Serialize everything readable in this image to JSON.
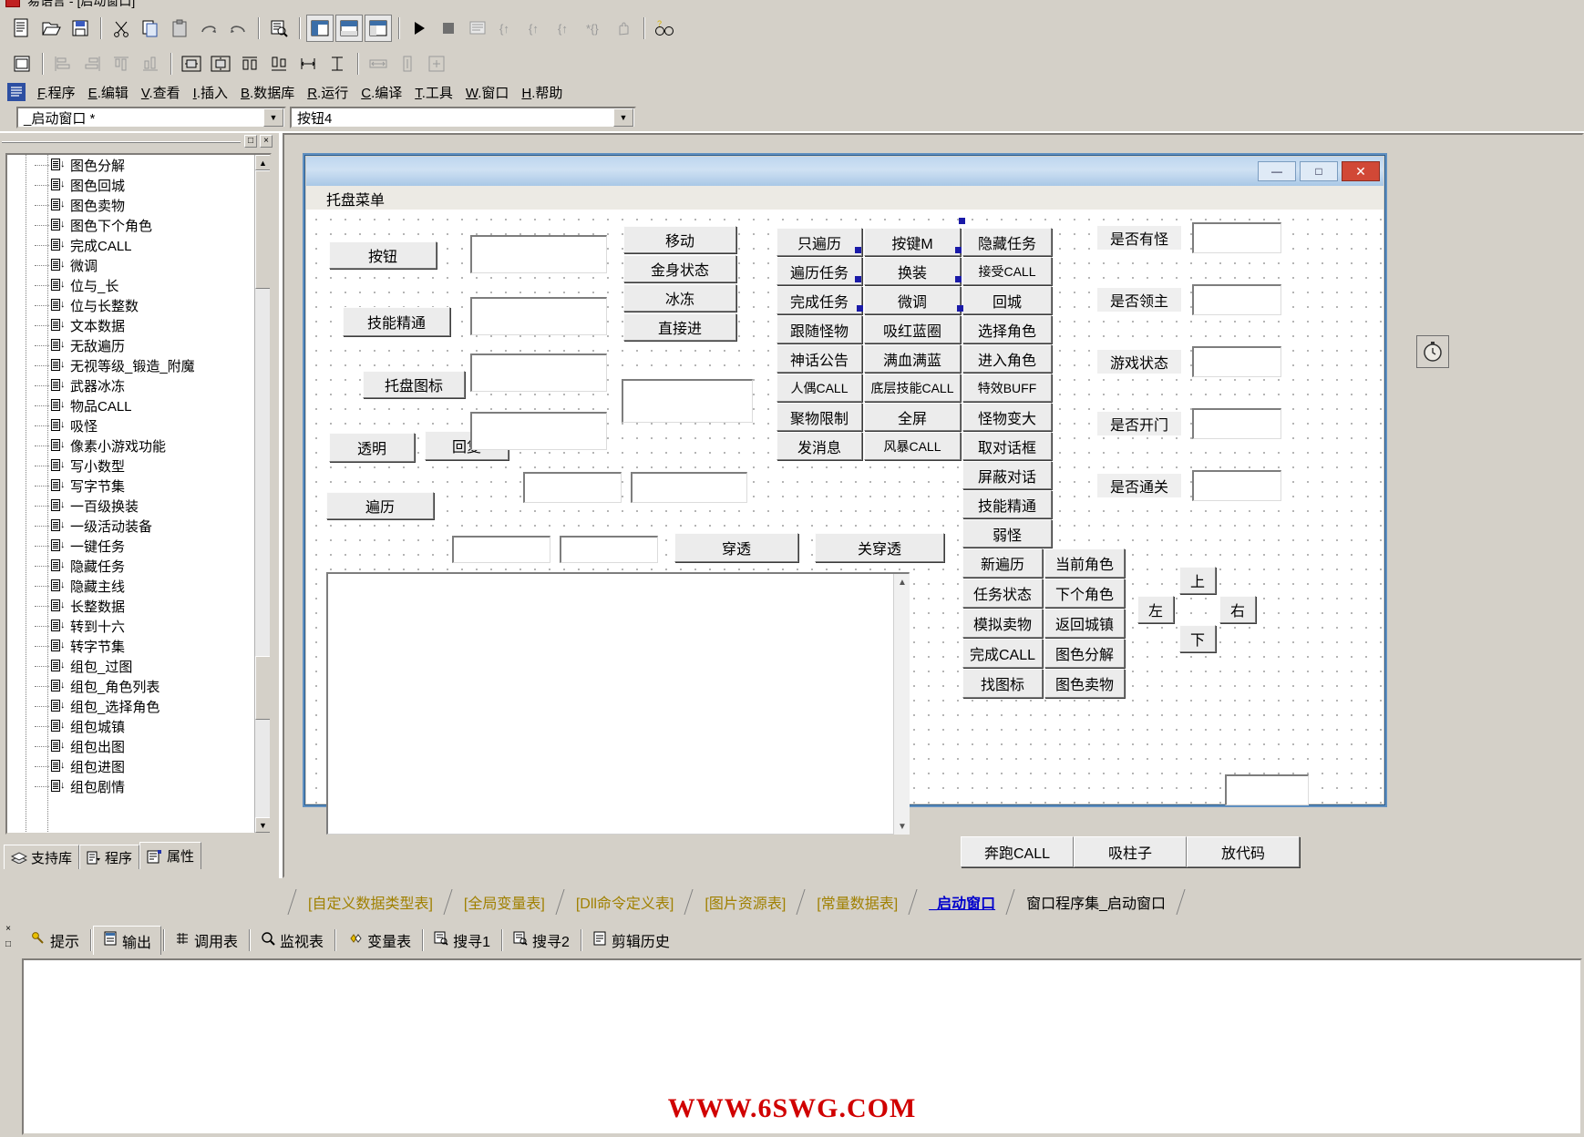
{
  "app": {
    "window_title": "易语言 - [启动窗口]",
    "logo_icon": "app-logo-icon"
  },
  "toolbar1": {
    "buttons": [
      {
        "name": "new-file",
        "icon": "new-document-icon",
        "label": "🗋"
      },
      {
        "name": "open-file",
        "icon": "open-folder-icon",
        "label": "🗁"
      },
      {
        "name": "save-file",
        "icon": "save-disk-icon",
        "label": "🖫"
      },
      {
        "name": "cut",
        "icon": "scissors-icon",
        "label": "✂"
      },
      {
        "name": "copy",
        "icon": "copy-icon",
        "label": "⧉"
      },
      {
        "name": "paste",
        "icon": "clipboard-icon",
        "label": "📋"
      },
      {
        "name": "redo",
        "icon": "redo-arrow-icon",
        "label": "↷"
      },
      {
        "name": "undo",
        "icon": "undo-arrow-icon",
        "label": "↶"
      },
      {
        "name": "find",
        "icon": "magnifier-page-icon",
        "label": "🔍"
      },
      {
        "name": "layout-left",
        "icon": "layout-left-icon",
        "label": "▤"
      },
      {
        "name": "layout-top",
        "icon": "layout-top-icon",
        "label": "▤"
      },
      {
        "name": "layout-grid",
        "icon": "layout-grid-icon",
        "label": "▦"
      },
      {
        "name": "run",
        "icon": "play-triangle-icon",
        "label": "▶"
      },
      {
        "name": "stop",
        "icon": "stop-square-icon",
        "label": "■"
      },
      {
        "name": "debug-window",
        "icon": "debug-window-icon",
        "label": "▨"
      },
      {
        "name": "step-into",
        "icon": "step-into-icon",
        "label": "{↑"
      },
      {
        "name": "step-over",
        "icon": "step-over-icon",
        "label": "{↑"
      },
      {
        "name": "step-out",
        "icon": "step-out-icon",
        "label": "{↑"
      },
      {
        "name": "run-to-cursor",
        "icon": "run-to-cursor-icon",
        "label": "*{}"
      },
      {
        "name": "pause-hand",
        "icon": "hand-icon",
        "label": "✋"
      },
      {
        "name": "search-tool",
        "icon": "binoculars-question-icon",
        "label": "🔎"
      }
    ]
  },
  "toolbar2": {
    "buttons": [
      {
        "name": "form-grid",
        "icon": "form-grid-icon",
        "label": "▤"
      },
      {
        "name": "align-left",
        "icon": "align-left-icon",
        "label": "⊫"
      },
      {
        "name": "align-right",
        "icon": "align-right-icon",
        "label": "⊨"
      },
      {
        "name": "align-top",
        "icon": "align-top-icon",
        "label": "⊼"
      },
      {
        "name": "align-bottom",
        "icon": "align-bottom-icon",
        "label": "⊻"
      },
      {
        "name": "center-horizontal",
        "icon": "center-h-icon",
        "label": "⬓"
      },
      {
        "name": "center-vertical",
        "icon": "center-v-icon",
        "label": "⬒"
      },
      {
        "name": "space-equal-h",
        "icon": "space-h-icon",
        "label": "凹"
      },
      {
        "name": "space-equal-v",
        "icon": "space-v-icon",
        "label": "啉"
      },
      {
        "name": "size-width",
        "icon": "size-width-icon",
        "label": ")-("
      },
      {
        "name": "size-height",
        "icon": "size-height-icon",
        "label": "工"
      },
      {
        "name": "stretch-h",
        "icon": "stretch-h-icon",
        "label": "↔"
      },
      {
        "name": "stretch-v",
        "icon": "stretch-v-icon",
        "label": "↕"
      },
      {
        "name": "stretch-both",
        "icon": "stretch-both-icon",
        "label": "⊞"
      }
    ]
  },
  "menu": {
    "items": [
      {
        "accel": "F",
        "text": ".程序"
      },
      {
        "accel": "E",
        "text": ".编辑"
      },
      {
        "accel": "V",
        "text": ".查看"
      },
      {
        "accel": "I",
        "text": ".插入"
      },
      {
        "accel": "B",
        "text": ".数据库"
      },
      {
        "accel": "R",
        "text": ".运行"
      },
      {
        "accel": "C",
        "text": ".编译"
      },
      {
        "accel": "T",
        "text": ".工具"
      },
      {
        "accel": "W",
        "text": ".窗口"
      },
      {
        "accel": "H",
        "text": ".帮助"
      }
    ]
  },
  "combos": {
    "object_combo": {
      "value": "_启动窗口 *",
      "arrow": "chevron-down-icon"
    },
    "member_combo": {
      "value": "按钮4",
      "arrow": "chevron-down-icon"
    }
  },
  "left_panel": {
    "restore_button": "□",
    "close_button": "×",
    "tree_items": [
      "图色分解",
      "图色回城",
      "图色卖物",
      "图色下个角色",
      "完成CALL",
      "微调",
      "位与_长",
      "位与长整数",
      "文本数据",
      "无敌遍历",
      "无视等级_锻造_附魔",
      "武器冰冻",
      "物品CALL",
      "吸怪",
      "像素小游戏功能",
      "写小数型",
      "写字节集",
      "一百级换装",
      "一级活动装备",
      "一键任务",
      "隐藏任务",
      "隐藏主线",
      "长整数据",
      "转到十六",
      "转字节集",
      "组包_过图",
      "组包_角色列表",
      "组包_选择角色",
      "组包城镇",
      "组包出图",
      "组包进图",
      "组包剧情"
    ],
    "tabs": [
      {
        "label": "支持库",
        "icon": "books-icon",
        "active": false
      },
      {
        "label": "程序",
        "icon": "program-doc-icon",
        "active": false
      },
      {
        "label": "属性",
        "icon": "properties-icon",
        "active": true
      }
    ]
  },
  "form": {
    "window_buttons": {
      "minimize": "—",
      "maximize": "□",
      "close": "✕"
    },
    "caption": "托盘菜单",
    "stopwatch_icon": "stopwatch-icon",
    "col_left_buttons": [
      "按钮",
      "技能精通",
      "托盘图标"
    ],
    "transparent_buttons": [
      "透明",
      "回复"
    ],
    "traverse_button": "遍历",
    "penetrate_buttons": [
      "穿透",
      "关穿透"
    ],
    "mid_buttons": [
      "移动",
      "金身状态",
      "冰冻",
      "直接进"
    ],
    "grid_col1": [
      "只遍历",
      "遍历任务",
      "完成任务",
      "跟随怪物",
      "神话公告",
      "人偶CALL",
      "聚物限制",
      "发消息"
    ],
    "grid_col2": [
      "按键M",
      "换装",
      "微调",
      "吸红蓝圈",
      "满血满蓝",
      "底层技能CALL",
      "全屏",
      "风暴CALL"
    ],
    "grid_col3": [
      "隐藏任务",
      "接受CALL",
      "回城",
      "选择角色",
      "进入角色",
      "特效BUFF",
      "怪物变大",
      "取对话框"
    ],
    "right_stack": [
      "屏蔽对话",
      "技能精通",
      "弱怪"
    ],
    "pair_rows": [
      [
        "新遍历",
        "当前角色"
      ],
      [
        "任务状态",
        "下个角色"
      ],
      [
        "模拟卖物",
        "返回城镇"
      ],
      [
        "完成CALL",
        "图色分解"
      ],
      [
        "找图标",
        "图色卖物"
      ]
    ],
    "bottom_buttons": [
      "奔跑CALL",
      "吸柱子",
      "放代码"
    ],
    "status_labels": [
      "是否有怪",
      "是否领主",
      "游戏状态",
      "是否开门",
      "是否通关"
    ],
    "dpad": {
      "up": "上",
      "left": "左",
      "right": "右",
      "down": "下"
    }
  },
  "doc_tabs": [
    {
      "label": "[自定义数据类型表]",
      "state": "normal"
    },
    {
      "label": "[全局变量表]",
      "state": "normal"
    },
    {
      "label": "[Dll命令定义表]",
      "state": "normal"
    },
    {
      "label": "[图片资源表]",
      "state": "normal"
    },
    {
      "label": "[常量数据表]",
      "state": "normal"
    },
    {
      "label": "_启动窗口",
      "state": "selected"
    },
    {
      "label": "窗口程序集_启动窗口",
      "state": "plain"
    }
  ],
  "output_tabs": [
    {
      "label": "提示",
      "icon": "question-key-icon",
      "active": false
    },
    {
      "label": "输出",
      "icon": "output-doc-icon",
      "active": true
    },
    {
      "label": "调用表",
      "icon": "call-table-icon",
      "active": false
    },
    {
      "label": "监视表",
      "icon": "magnifier-icon",
      "active": false
    },
    {
      "label": "变量表",
      "icon": "diamond-icon",
      "active": false
    },
    {
      "label": "搜寻1",
      "icon": "search-page-icon",
      "active": false
    },
    {
      "label": "搜寻2",
      "icon": "search-page-icon",
      "active": false
    },
    {
      "label": "剪辑历史",
      "icon": "clip-history-icon",
      "active": false
    }
  ],
  "output_pane": {
    "close_button": "×",
    "restore_button": "□"
  },
  "watermark": "WWW.6SWG.COM",
  "colors": {
    "chrome": "#d4d0c8",
    "tab_yellow": "#a08000",
    "tab_selected_blue": "#0000cc",
    "watermark_red": "#d00000",
    "handle_blue": "#1a1aa8",
    "form_title_blue": "#bed6ef"
  }
}
